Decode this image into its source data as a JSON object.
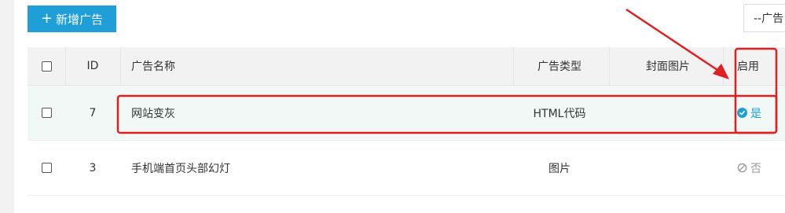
{
  "toolbar": {
    "add_button": {
      "plus": "+",
      "label": "新增广告"
    },
    "filter_select": {
      "value": "--广告"
    }
  },
  "table": {
    "headers": {
      "id": "ID",
      "name": "广告名称",
      "type": "广告类型",
      "cover": "封面图片",
      "enable": "启用"
    },
    "rows": [
      {
        "id": "7",
        "name": "网站变灰",
        "type": "HTML代码",
        "cover": "",
        "enabled": "是",
        "enabled_icon": "check-circle-icon"
      },
      {
        "id": "3",
        "name": "手机端首页头部幻灯",
        "type": "图片",
        "cover": "",
        "enabled": "否",
        "enabled_icon": "ban-icon"
      }
    ]
  },
  "colors": {
    "primary": "#1e9fd8",
    "annotation": "#e02020",
    "header_bg": "#f2f2f2",
    "selected_row_bg": "#f1f8f5"
  }
}
